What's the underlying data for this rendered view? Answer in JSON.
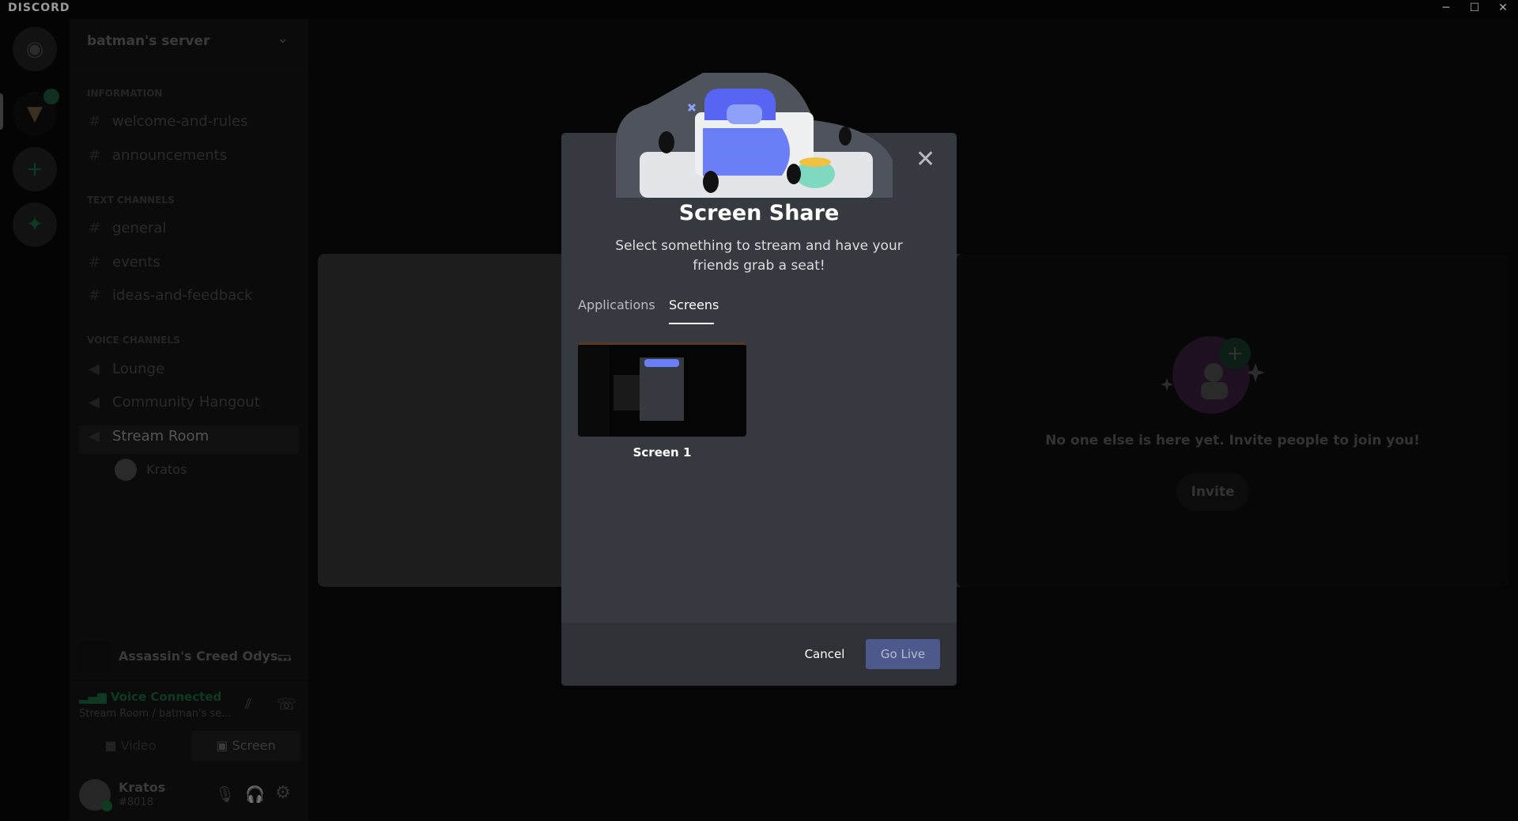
{
  "titlebar": {
    "brand": "DISCORD",
    "minimize": "─",
    "maximize": "☐",
    "close": "✕"
  },
  "server": {
    "name": "batman's server",
    "categories": [
      {
        "name": "INFORMATION",
        "channels": [
          "welcome-and-rules",
          "announcements"
        ]
      },
      {
        "name": "TEXT CHANNELS",
        "channels": [
          "general",
          "events",
          "ideas-and-feedback"
        ]
      },
      {
        "name": "VOICE CHANNELS",
        "channels": [
          "Lounge",
          "Community Hangout",
          "Stream Room"
        ]
      }
    ],
    "voice_user": "Kratos"
  },
  "activity": {
    "game": "Assassin's Creed Odys..."
  },
  "voice": {
    "status": "Voice Connected",
    "location": "Stream Room / batman's se...",
    "video": "Video",
    "screen": "Screen"
  },
  "user": {
    "name": "Kratos",
    "tag": "#8018"
  },
  "invite": {
    "text": "No one else is here yet. Invite people to join you!",
    "button": "Invite"
  },
  "modal": {
    "title": "Screen Share",
    "subtitle": "Select something to stream and have your friends grab a seat!",
    "tabs": [
      {
        "label": "Applications",
        "active": false
      },
      {
        "label": "Screens",
        "active": true
      }
    ],
    "sources": [
      {
        "label": "Screen 1"
      }
    ],
    "cancel": "Cancel",
    "go_live": "Go Live"
  },
  "colors": {
    "accent": "#5865f2",
    "voice_green": "#3ba55d",
    "modal_bg": "#36393f"
  }
}
